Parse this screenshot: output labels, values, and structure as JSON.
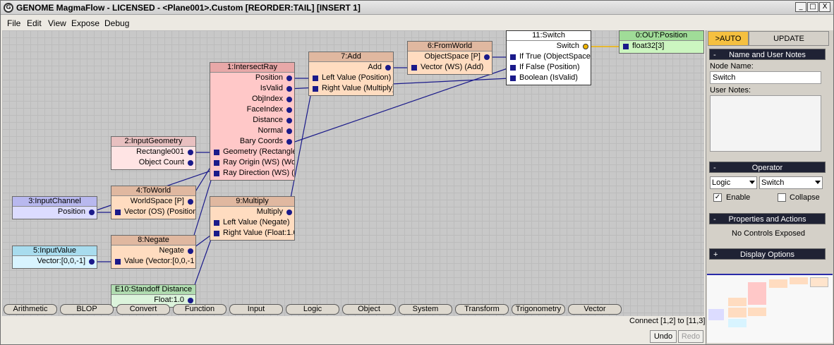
{
  "window": {
    "title": "GENOME MagmaFlow - LICENSED - <Plane001>.Custom [REORDER:TAIL] [INSERT 1]",
    "app_icon_glyph": "G",
    "minimize_glyph": "_",
    "maximize_glyph": "□",
    "close_glyph": "X"
  },
  "menu": [
    "File",
    "Edit",
    "View",
    "Expose",
    "Debug"
  ],
  "nodes": {
    "intersect": {
      "title": "1:IntersectRay",
      "outputs": [
        "Position",
        "IsValid",
        "ObjIndex",
        "FaceIndex",
        "Distance",
        "Normal",
        "Bary Coords"
      ],
      "inputs": [
        "Geometry (Rectangle",
        "Ray Origin (WS) (Wo",
        "Ray Direction (WS) ("
      ]
    },
    "geometry": {
      "title": "2:InputGeometry",
      "outputs": [
        "Rectangle001",
        "Object Count"
      ]
    },
    "channel": {
      "title": "3:InputChannel",
      "outputs": [
        "Position"
      ]
    },
    "toworld": {
      "title": "4:ToWorld",
      "outputs": [
        "WorldSpace [P]"
      ],
      "inputs": [
        "Vector (OS) (Position"
      ]
    },
    "value": {
      "title": "5:InputValue",
      "outputs": [
        "Vector:[0,0,-1]"
      ]
    },
    "negate": {
      "title": "8:Negate",
      "outputs": [
        "Negate"
      ],
      "inputs": [
        "Value (Vector:[0,0,-1"
      ]
    },
    "standoff": {
      "title": "E10:Standoff Distance",
      "outputs": [
        "Float:1.0"
      ]
    },
    "multiply": {
      "title": "9:Multiply",
      "outputs": [
        "Multiply"
      ],
      "inputs": [
        "Left Value (Negate)",
        "Right Value (Float:1.0"
      ]
    },
    "add": {
      "title": "7:Add",
      "outputs": [
        "Add"
      ],
      "inputs": [
        "Left Value (Position)",
        "Right Value (Multiply)"
      ]
    },
    "fromworld": {
      "title": "6:FromWorld",
      "outputs": [
        "ObjectSpace [P]"
      ],
      "inputs": [
        "Vector (WS) (Add)"
      ]
    },
    "switch": {
      "title": "11:Switch",
      "outputs": [
        "Switch"
      ],
      "inputs": [
        "If True (ObjectSpace",
        "If False (Position)",
        "Boolean (IsValid)"
      ]
    },
    "output": {
      "title": "0:OUT:Position",
      "inputs": [
        "float32[3]"
      ]
    }
  },
  "category_tabs": [
    "Arithmetic",
    "BLOP",
    "Convert",
    "Function",
    "Input",
    "Logic",
    "Object",
    "System",
    "Transform",
    "Trigonometry",
    "Vector"
  ],
  "status": {
    "connect": "Connect [1,2] to [11,3]"
  },
  "history": {
    "undo": "Undo",
    "redo": "Redo"
  },
  "panel": {
    "tab_auto": ">AUTO",
    "tab_update": "UPDATE",
    "name_rollout": "Name and User Notes",
    "node_name_label": "Node Name:",
    "node_name_value": "Switch",
    "user_notes_label": "User Notes:",
    "operator_rollout": "Operator",
    "operator_category": "Logic",
    "operator_type": "Switch",
    "enable_label": "Enable",
    "enable_checked": "✓",
    "collapse_label": "Collapse",
    "props_rollout": "Properties and Actions",
    "props_text": "No Controls Exposed",
    "display_rollout": "Display Options",
    "collapse_sign": "-",
    "expand_sign": "+"
  },
  "colors": {
    "wire": "#1a1a8a",
    "selected_wire": "#f0b400",
    "rollout_bg": "#1f2234",
    "auto_tab": "#f5c040"
  }
}
